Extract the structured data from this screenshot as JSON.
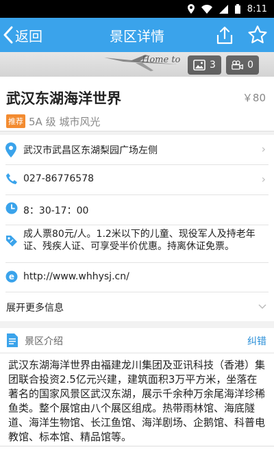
{
  "status_bar": {
    "time": "8:11"
  },
  "nav": {
    "back_label": "返回",
    "title": "景区详情"
  },
  "banner": {
    "text": "Home to"
  },
  "media": {
    "photo_count": "3",
    "video_count": "0"
  },
  "spot": {
    "name": "武汉东湖海洋世界",
    "price": "￥80",
    "tag": "推荐",
    "subtitle": "5A 级  城市风光"
  },
  "info": {
    "address": "武汉市武昌区东湖梨园广场左侧",
    "phone": "027-86776578",
    "hours": "8：30-17：00",
    "ticket": "成人票80元/人。1.2米以下的儿童、现役军人及持老年证、残疾人证、可享受半价优惠。持离休证免票。",
    "website": "http://www.whhysj.cn/",
    "expand_label": "展开更多信息"
  },
  "intro": {
    "title": "景区介绍",
    "report_label": "纠错",
    "body": "武汉东湖海洋世界由福建龙川集团及亚讯科技（香港）集团联合投资2.5亿元兴建，建筑面积3万平方米，坐落在著名的国家风景区武汉东湖，展示千余种万余尾海洋珍稀鱼类。整个展馆由八个展区组成。热带雨林馆、海底隧道、海洋生物馆、长江鱼馆、海洋剧场、企鹅馆、科普电教馆、标本馆、精品馆等。"
  },
  "colors": {
    "nav_bg": "#3aa3eb",
    "accent": "#2a8fd8",
    "tag": "#f38b30"
  }
}
